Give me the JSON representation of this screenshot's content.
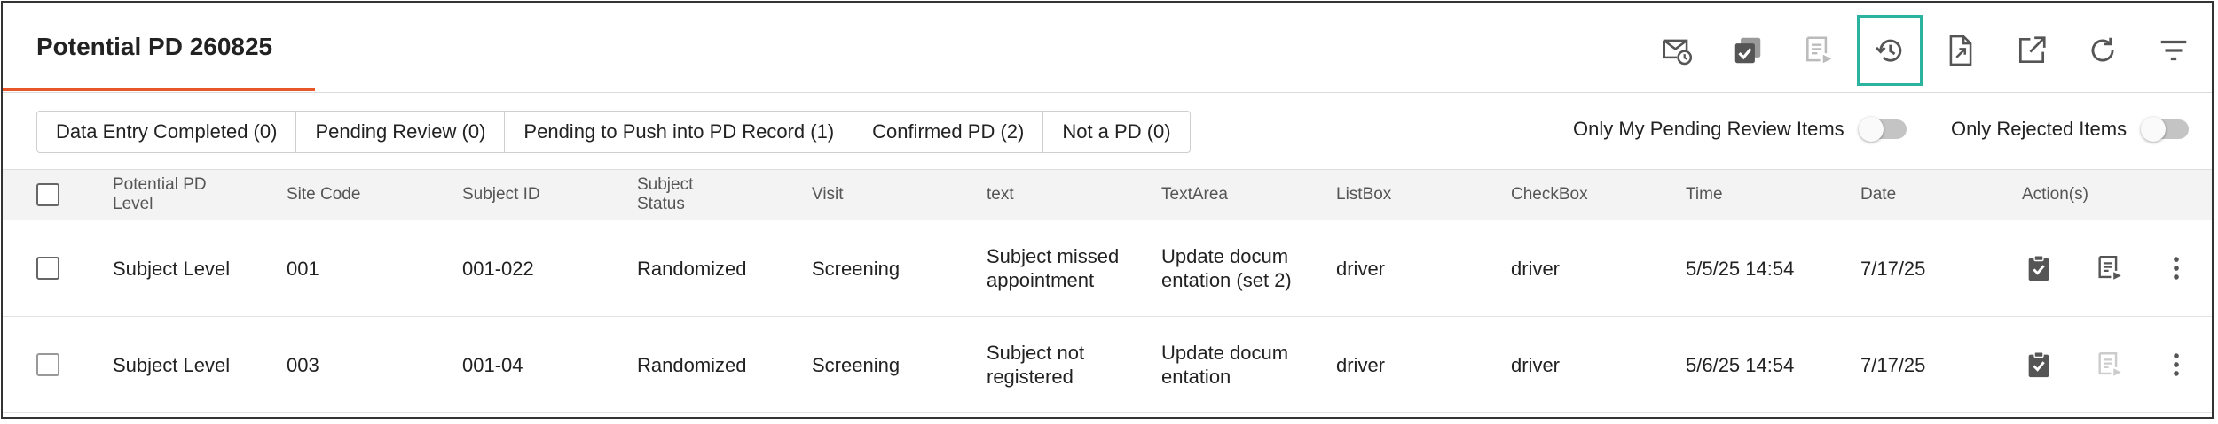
{
  "page": {
    "title": "Potential PD 260825"
  },
  "toolbar": {
    "buttons": [
      {
        "name": "email-schedule-icon"
      },
      {
        "name": "bulk-approve-icon"
      },
      {
        "name": "push-review-icon"
      },
      {
        "name": "history-icon"
      },
      {
        "name": "export-file-icon"
      },
      {
        "name": "open-external-icon"
      },
      {
        "name": "refresh-icon"
      },
      {
        "name": "filter-icon"
      }
    ]
  },
  "filters": [
    "Data Entry Completed (0)",
    "Pending Review (0)",
    "Pending to Push into PD Record (1)",
    "Confirmed PD (2)",
    "Not a PD (0)"
  ],
  "toggles": {
    "pending": {
      "label": "Only My Pending Review Items",
      "on": false
    },
    "rejected": {
      "label": "Only Rejected Items",
      "on": false
    }
  },
  "table": {
    "headers": [
      "Potential PD Level",
      "Site Code",
      "Subject ID",
      "Subject Status",
      "Visit",
      "text",
      "TextArea",
      "ListBox",
      "CheckBox",
      "Time",
      "Date",
      "Action(s)"
    ],
    "rows": [
      {
        "level": "Subject Level",
        "site": "001",
        "subject_id": "001-022",
        "status": "Randomized",
        "visit": "Screening",
        "text": "Subject missed appointment",
        "textarea": "Update documentation (set 2)",
        "listbox": "driver",
        "checkbox": "driver",
        "time": "5/5/25 14:54",
        "date": "7/17/25",
        "push_enabled": true
      },
      {
        "level": "Subject Level",
        "site": "003",
        "subject_id": "001-04",
        "status": "Randomized",
        "visit": "Screening",
        "text": "Subject not registered",
        "textarea": "Update documentation",
        "listbox": "driver",
        "checkbox": "driver",
        "time": "5/6/25 14:54",
        "date": "7/17/25",
        "push_enabled": false
      }
    ]
  },
  "colors": {
    "accent": "#e8572a",
    "active_outline": "#2bb3a0",
    "icon": "#555555",
    "icon_disabled": "#cccccc"
  }
}
